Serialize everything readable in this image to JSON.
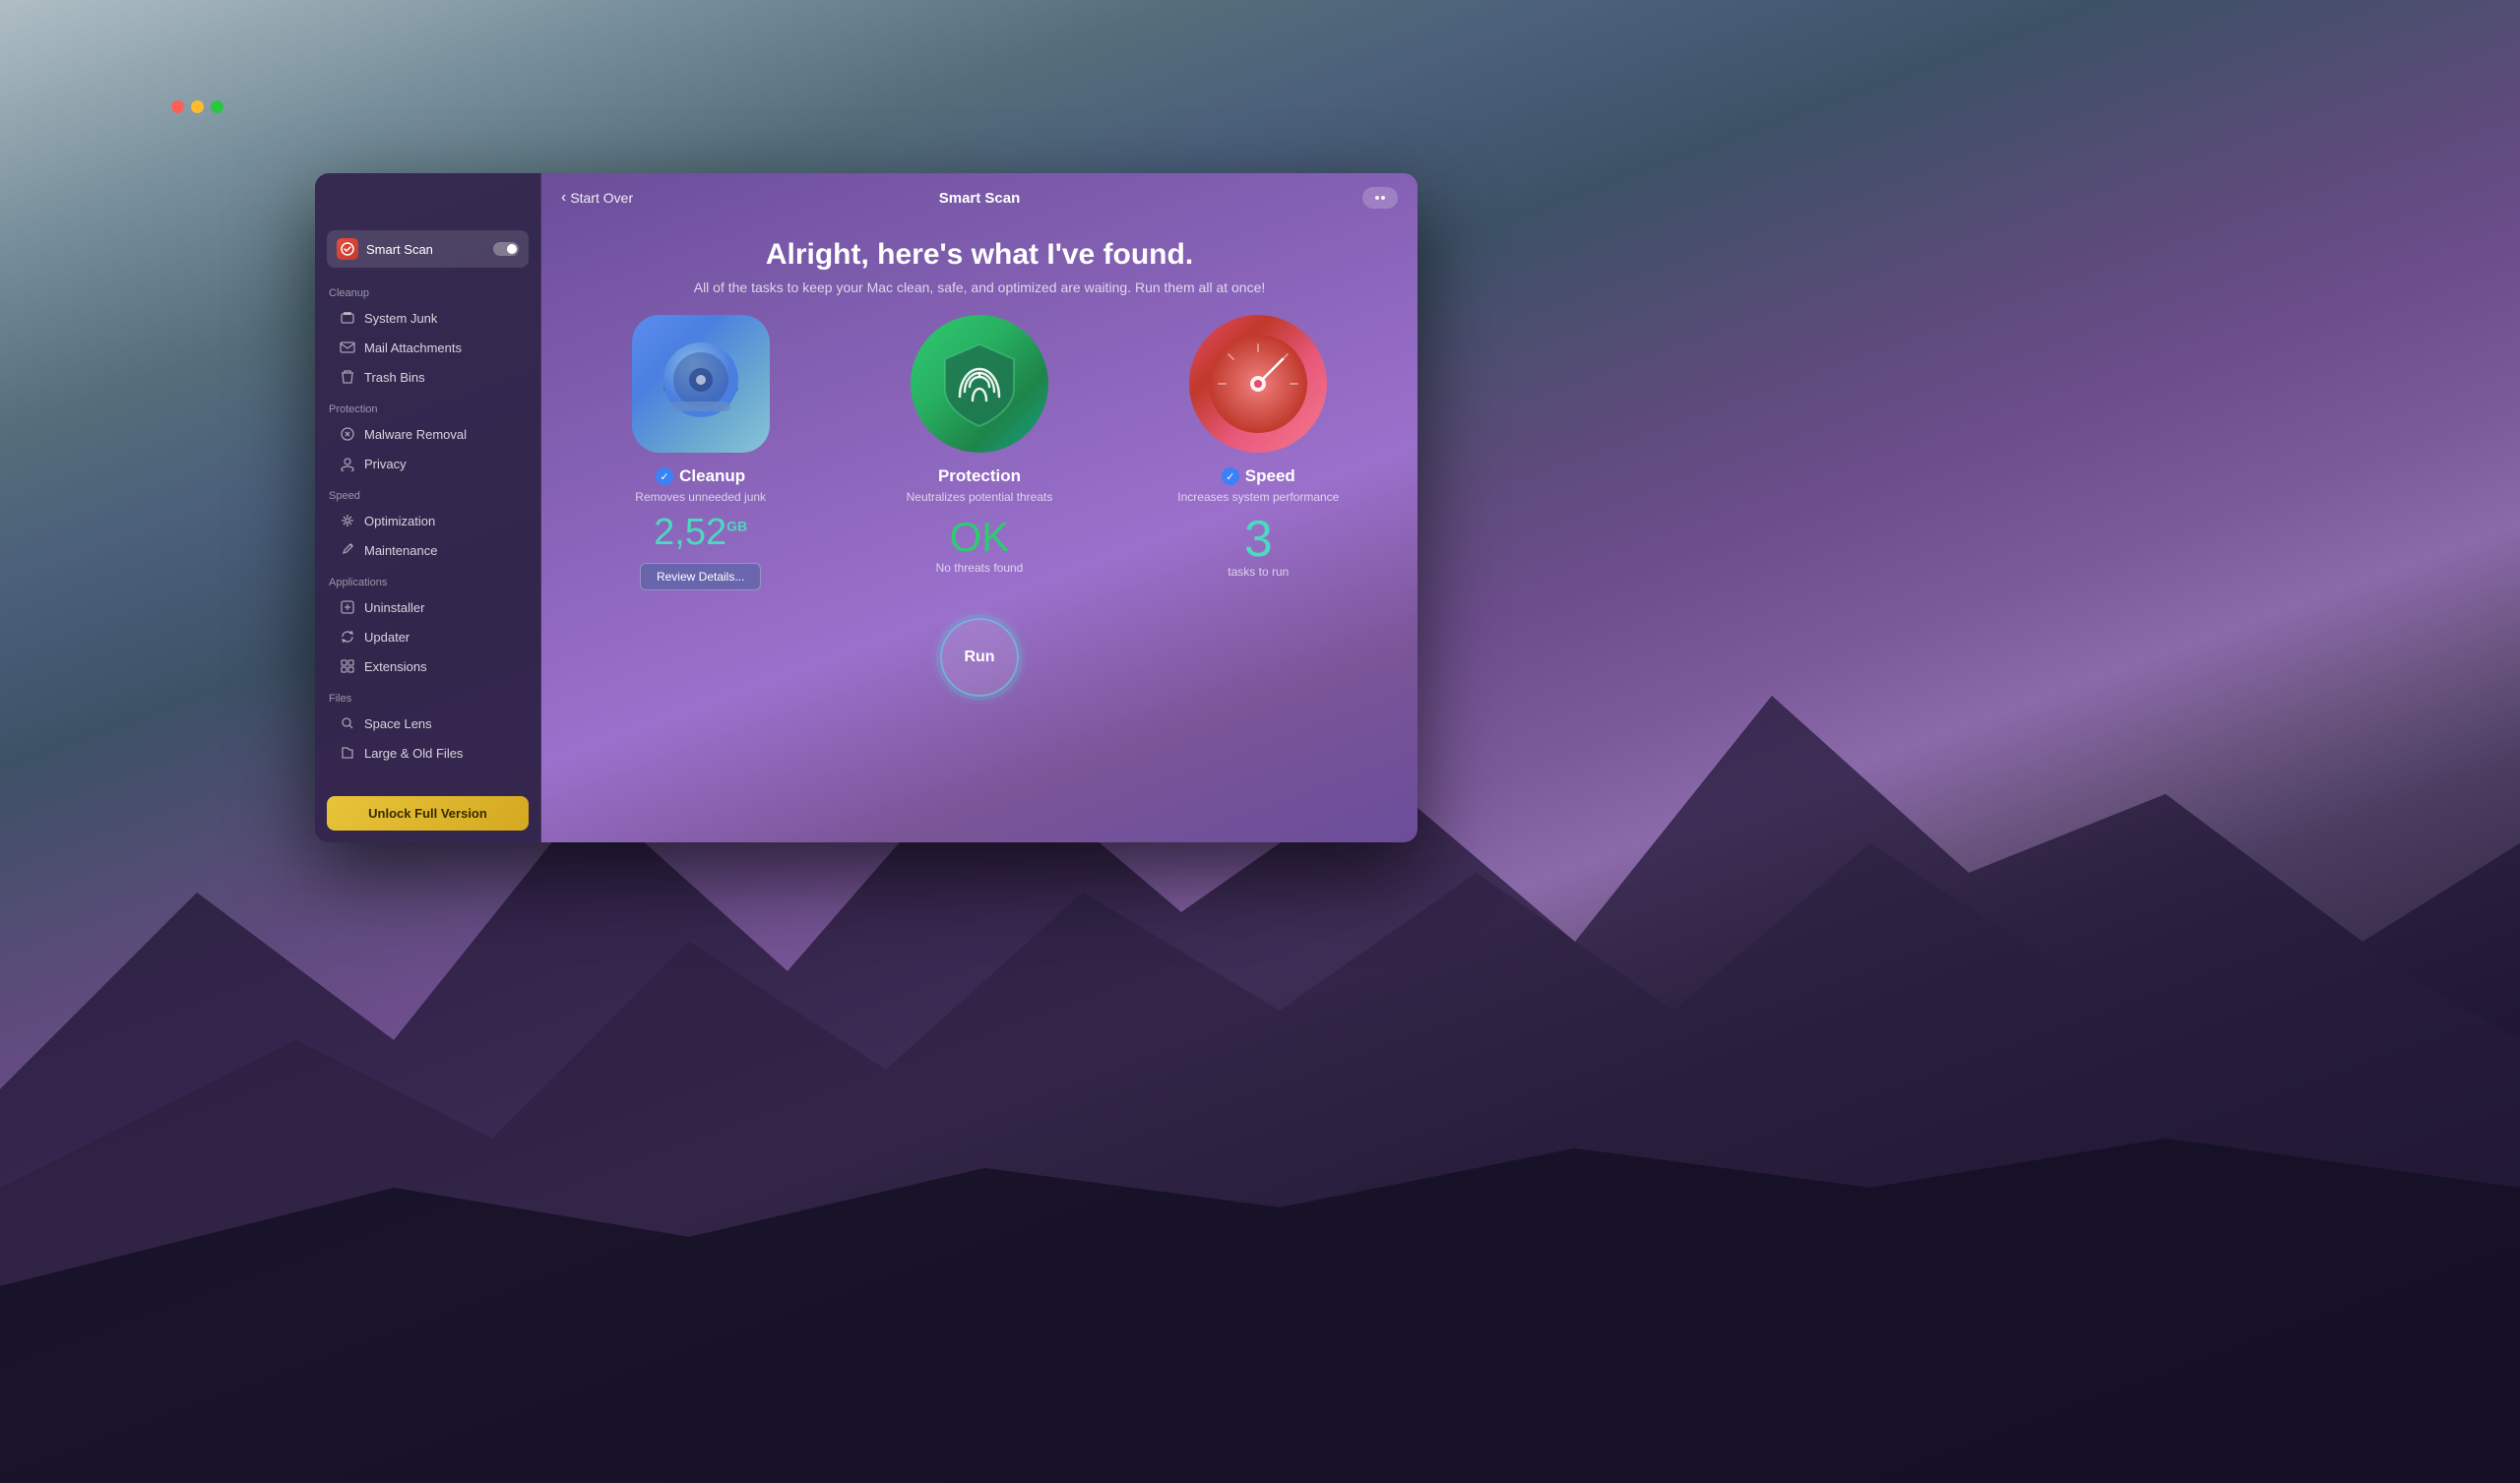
{
  "desktop": {
    "bg": "macOS mountain background"
  },
  "window": {
    "title": "Smart Scan",
    "traffic_lights": [
      "red",
      "yellow",
      "green"
    ]
  },
  "titlebar": {
    "back_label": "Start Over",
    "title": "Smart Scan"
  },
  "sidebar": {
    "smart_scan_label": "Smart Scan",
    "sections": [
      {
        "label": "Cleanup",
        "items": [
          {
            "label": "System Junk",
            "icon": "🖥"
          },
          {
            "label": "Mail Attachments",
            "icon": "✉"
          },
          {
            "label": "Trash Bins",
            "icon": "🗑"
          }
        ]
      },
      {
        "label": "Protection",
        "items": [
          {
            "label": "Malware Removal",
            "icon": "🦠"
          },
          {
            "label": "Privacy",
            "icon": "👁"
          }
        ]
      },
      {
        "label": "Speed",
        "items": [
          {
            "label": "Optimization",
            "icon": "⚡"
          },
          {
            "label": "Maintenance",
            "icon": "🔧"
          }
        ]
      },
      {
        "label": "Applications",
        "items": [
          {
            "label": "Uninstaller",
            "icon": "📦"
          },
          {
            "label": "Updater",
            "icon": "🔄"
          },
          {
            "label": "Extensions",
            "icon": "🧩"
          }
        ]
      },
      {
        "label": "Files",
        "items": [
          {
            "label": "Space Lens",
            "icon": "🔍"
          },
          {
            "label": "Large & Old Files",
            "icon": "📁"
          }
        ]
      }
    ],
    "unlock_btn_label": "Unlock Full Version"
  },
  "main": {
    "hero_title": "Alright, here's what I've found.",
    "hero_subtitle": "All of the tasks to keep your Mac clean, safe, and optimized are waiting. Run them all at once!",
    "cards": [
      {
        "id": "cleanup",
        "name": "Cleanup",
        "desc": "Removes unneeded junk",
        "value": "2,52",
        "unit": "GB",
        "sublabel": null,
        "btn_label": "Review Details...",
        "status": "checked",
        "color": "blue"
      },
      {
        "id": "protection",
        "name": "Protection",
        "desc": "Neutralizes potential threats",
        "value": "OK",
        "unit": null,
        "sublabel": "No threats found",
        "btn_label": null,
        "status": "neutral",
        "color": "green"
      },
      {
        "id": "speed",
        "name": "Speed",
        "desc": "Increases system performance",
        "value": "3",
        "unit": null,
        "sublabel": "tasks to run",
        "btn_label": null,
        "status": "checked",
        "color": "teal"
      }
    ],
    "run_btn_label": "Run"
  }
}
